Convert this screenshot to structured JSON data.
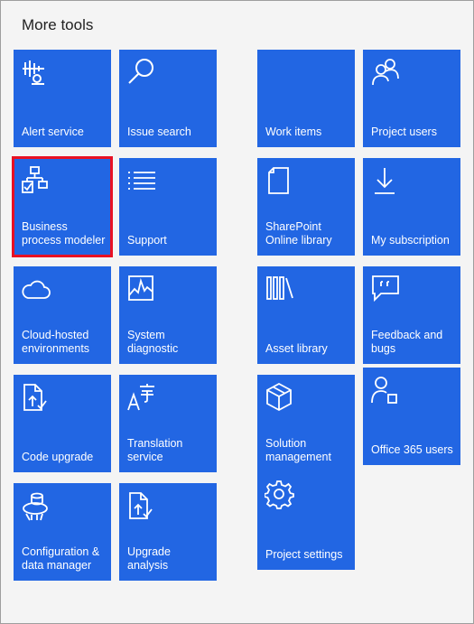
{
  "panel": {
    "title": "More tools"
  },
  "tiles": {
    "alert_service": {
      "label": "Alert service",
      "icon": "alert-service-icon"
    },
    "issue_search": {
      "label": "Issue search",
      "icon": "search-icon"
    },
    "business_process_modeler": {
      "label": "Business process modeler",
      "icon": "process-hierarchy-icon",
      "selected": true
    },
    "support": {
      "label": "Support",
      "icon": "list-icon"
    },
    "cloud_hosted": {
      "label": "Cloud-hosted environments",
      "icon": "cloud-icon"
    },
    "system_diagnostic": {
      "label": "System diagnostic",
      "icon": "diagnostic-chart-icon"
    },
    "code_upgrade": {
      "label": "Code upgrade",
      "icon": "document-upgrade-icon"
    },
    "translation_service": {
      "label": "Translation service",
      "icon": "translate-icon"
    },
    "config_data_manager": {
      "label": "Configuration & data manager",
      "icon": "data-manager-icon"
    },
    "upgrade_analysis": {
      "label": "Upgrade analysis",
      "icon": "document-check-icon"
    },
    "work_items": {
      "label": "Work items",
      "icon": ""
    },
    "project_users": {
      "label": "Project users",
      "icon": "people-icon"
    },
    "sharepoint_library": {
      "label": "SharePoint Online library",
      "icon": "document-page-icon"
    },
    "my_subscription": {
      "label": "My subscription",
      "icon": "download-icon"
    },
    "asset_library": {
      "label": "Asset library",
      "icon": "library-icon"
    },
    "feedback_bugs": {
      "label": "Feedback and bugs",
      "icon": "feedback-icon"
    },
    "solution_management": {
      "label": "Solution management",
      "icon": "package-icon"
    },
    "office365_users": {
      "label": "Office 365 users",
      "icon": "user-app-icon"
    },
    "project_settings": {
      "label": "Project settings",
      "icon": "gear-icon"
    }
  },
  "colors": {
    "tile": "#2266e3",
    "selected_border": "#e81123",
    "panel_bg": "#f4f4f4"
  }
}
